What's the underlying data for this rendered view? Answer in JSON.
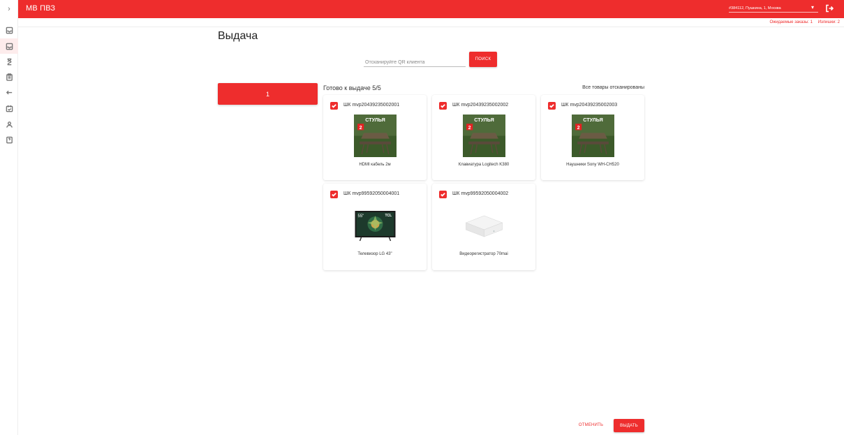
{
  "app": {
    "title": "МВ ПВЗ"
  },
  "header": {
    "location": "#384112, Пушкина, 1, Москва"
  },
  "subheader": {
    "expected_orders": "Ожидаемые заказы: 1",
    "surplus": "Излишки: 2"
  },
  "page": {
    "title": "Выдача"
  },
  "search": {
    "placeholder": "Отсканируйте QR клиента",
    "value": "",
    "button_label": "ПОИСК"
  },
  "order": {
    "number": "1"
  },
  "summary": {
    "ready": "Готово к выдаче 5/5",
    "status": "Все товары отсканированы"
  },
  "items": [
    {
      "sku": "ШК mvp20439235002001",
      "name": "HDMI кабель 2м",
      "checked": true,
      "image": "chair-promo",
      "badge": "СТУЛЬЯ",
      "badge_num": "2"
    },
    {
      "sku": "ШК mvp20439235002002",
      "name": "Клавиатура Logitech K380",
      "checked": true,
      "image": "chair-promo",
      "badge": "СТУЛЬЯ",
      "badge_num": "2"
    },
    {
      "sku": "ШК mvp20439235002003",
      "name": "Наушники Sony WH-CH520",
      "checked": true,
      "image": "chair-promo",
      "badge": "СТУЛЬЯ",
      "badge_num": "2"
    },
    {
      "sku": "ШК mvp99592050004001",
      "name": "Телевизор LG 43\"",
      "checked": true,
      "image": "tv",
      "badge": "55\"",
      "brand": "TCL"
    },
    {
      "sku": "ШК mvp99592050004002",
      "name": "Видеорегистратор 70mai",
      "checked": true,
      "image": "white-box"
    }
  ],
  "actions": {
    "cancel_label": "ОТМЕНИТЬ",
    "issue_label": "ВЫДАТЬ"
  },
  "colors": {
    "accent": "#ee2d2d",
    "active_bg": "#fdecec"
  },
  "icons": {
    "rail": [
      "chevron-right-icon",
      "inbox-icon",
      "inbox-out-icon",
      "hourglass-icon",
      "clipboard-icon",
      "return-arrow-icon",
      "calendar-check-icon",
      "users-icon",
      "help-doc-icon"
    ],
    "header": [
      "caret-down-icon",
      "logout-icon"
    ]
  }
}
